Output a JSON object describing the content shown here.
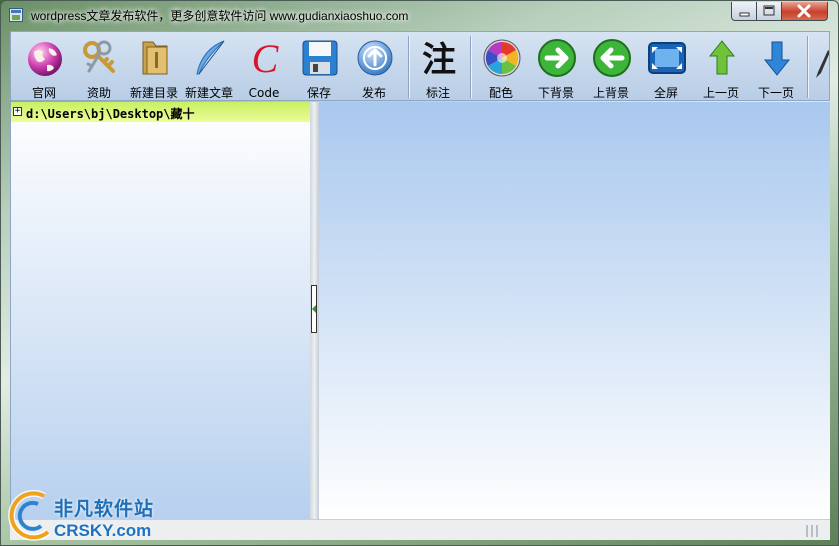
{
  "window": {
    "title": "wordpress文章发布软件，更多创意软件访问 www.gudianxiaoshuo.com"
  },
  "toolbar": {
    "buttons": [
      {
        "label": "官网",
        "icon": "globe-icon"
      },
      {
        "label": "资助",
        "icon": "keys-icon"
      },
      {
        "label": "新建目录",
        "icon": "folder-icon"
      },
      {
        "label": "新建文章",
        "icon": "feather-icon"
      },
      {
        "label": "Code",
        "icon": "code-c-icon"
      },
      {
        "label": "保存",
        "icon": "floppy-disk-icon"
      },
      {
        "label": "发布",
        "icon": "upload-icon"
      },
      {
        "label": "标注",
        "icon": "annotate-icon",
        "glyph": "注"
      },
      {
        "label": "配色",
        "icon": "color-wheel-icon"
      },
      {
        "label": "下背景",
        "icon": "arrow-right-icon"
      },
      {
        "label": "上背景",
        "icon": "arrow-left-icon"
      },
      {
        "label": "全屏",
        "icon": "fullscreen-icon"
      },
      {
        "label": "上一页",
        "icon": "arrow-up-icon"
      },
      {
        "label": "下一页",
        "icon": "arrow-down-icon"
      }
    ]
  },
  "tree": {
    "root_path": "d:\\Users\\bj\\Desktop\\藏十",
    "expander": "+"
  },
  "watermark": {
    "text": "非凡软件站",
    "sub": "CRSKY.com"
  },
  "colors": {
    "tree_row_highlight": "#d4f57a",
    "content_top": "#a9c8ee",
    "close_button": "#c7412b"
  }
}
